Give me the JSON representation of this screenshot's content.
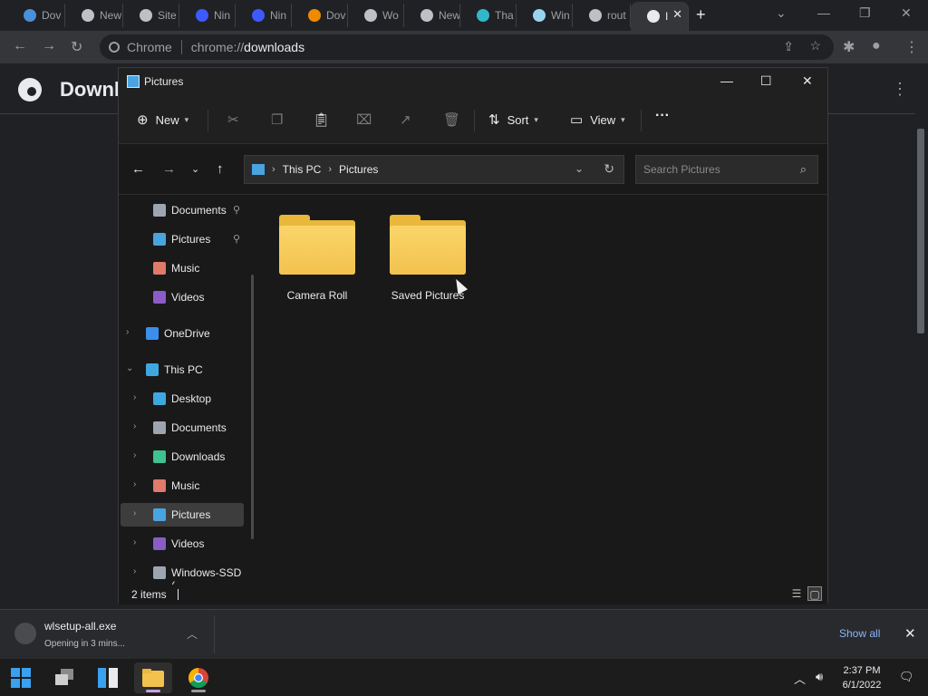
{
  "browser": {
    "tabs": [
      {
        "label": "Dov",
        "icon": "download-site-icon",
        "color": "#4a90d9"
      },
      {
        "label": "New",
        "icon": "chrome-icon",
        "color": "#bdc1c6"
      },
      {
        "label": "Site",
        "icon": "globe-icon",
        "color": "#bdc1c6"
      },
      {
        "label": "Nin",
        "icon": "ninite-icon",
        "color": "#3d5afe"
      },
      {
        "label": "Nin",
        "icon": "ninite-icon",
        "color": "#3d5afe"
      },
      {
        "label": "Dov",
        "icon": "vlc-icon",
        "color": "#f08a00"
      },
      {
        "label": "Wo",
        "icon": "globe-icon",
        "color": "#bdc1c6"
      },
      {
        "label": "New",
        "icon": "chrome-icon",
        "color": "#bdc1c6"
      },
      {
        "label": "Tha",
        "icon": "chevron-site-icon",
        "color": "#30b8c8"
      },
      {
        "label": "Win",
        "icon": "clapper-icon",
        "color": "#9ad3f0"
      },
      {
        "label": "rout",
        "icon": "globe-icon",
        "color": "#bdc1c6"
      },
      {
        "label": "I",
        "icon": "download-icon",
        "color": "#e8eaed"
      }
    ],
    "new_tab": "+",
    "minimize": "—",
    "restore": "❐",
    "close": "✕",
    "tab_list": "⌄",
    "omnibox": {
      "site": "Chrome",
      "scheme": "chrome://",
      "host": "downloads"
    }
  },
  "downloads_page": {
    "title": "Downl"
  },
  "explorer": {
    "title": "Pictures",
    "commands": {
      "new": "New",
      "sort": "Sort",
      "view": "View"
    },
    "address": {
      "root": "This PC",
      "current": "Pictures"
    },
    "search_placeholder": "Search Pictures",
    "sidebar": [
      {
        "label": "Documents",
        "icon": "documents-icon",
        "color": "#9da6b0",
        "pinned": true
      },
      {
        "label": "Pictures",
        "icon": "pictures-icon",
        "color": "#4aa3df",
        "pinned": true
      },
      {
        "label": "Music",
        "icon": "music-icon",
        "color": "#e07a6a"
      },
      {
        "label": "Videos",
        "icon": "videos-icon",
        "color": "#8b5cc8"
      },
      {
        "label": "OneDrive",
        "icon": "onedrive-icon",
        "color": "#3b8eea"
      },
      {
        "label": "This PC",
        "icon": "this-pc-icon",
        "color": "#3fa7e0"
      },
      {
        "label": "Desktop",
        "icon": "desktop-icon",
        "color": "#3fa7e0"
      },
      {
        "label": "Documents",
        "icon": "documents-icon",
        "color": "#9da6b0"
      },
      {
        "label": "Downloads",
        "icon": "downloads-icon",
        "color": "#3ec28f"
      },
      {
        "label": "Music",
        "icon": "music-icon",
        "color": "#e07a6a"
      },
      {
        "label": "Pictures",
        "icon": "pictures-icon",
        "color": "#4aa3df",
        "selected": true
      },
      {
        "label": "Videos",
        "icon": "videos-icon",
        "color": "#8b5cc8"
      },
      {
        "label": "Windows-SSD (",
        "icon": "drive-icon",
        "color": "#9da6b0"
      }
    ],
    "folders": [
      {
        "label": "Camera Roll"
      },
      {
        "label": "Saved Pictures"
      }
    ],
    "status": "2 items"
  },
  "shelf": {
    "filename": "wlsetup-all.exe",
    "status": "Opening in 3 mins...",
    "show_all": "Show all"
  },
  "taskbar": {
    "time": "2:37 PM",
    "date": "6/1/2022"
  }
}
